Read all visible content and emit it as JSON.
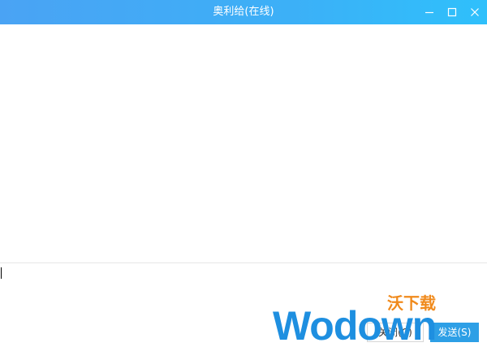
{
  "window": {
    "title": "奥利给(在线)"
  },
  "controls": {
    "minimize_icon": "minimize-icon",
    "maximize_icon": "maximize-icon",
    "close_icon": "close-icon"
  },
  "composer": {
    "input_value": ""
  },
  "actions": {
    "close_label": "关闭(C)",
    "send_label": "发送(S)"
  },
  "watermark": {
    "brand": "Wodown",
    "badge": "沃下载"
  },
  "colors": {
    "titlebar_start": "#4aa3f4",
    "titlebar_end": "#2fc0fb",
    "send_button": "#2d9fe6",
    "watermark_blue": "#1e8fe0",
    "watermark_orange": "#f08a1c"
  }
}
